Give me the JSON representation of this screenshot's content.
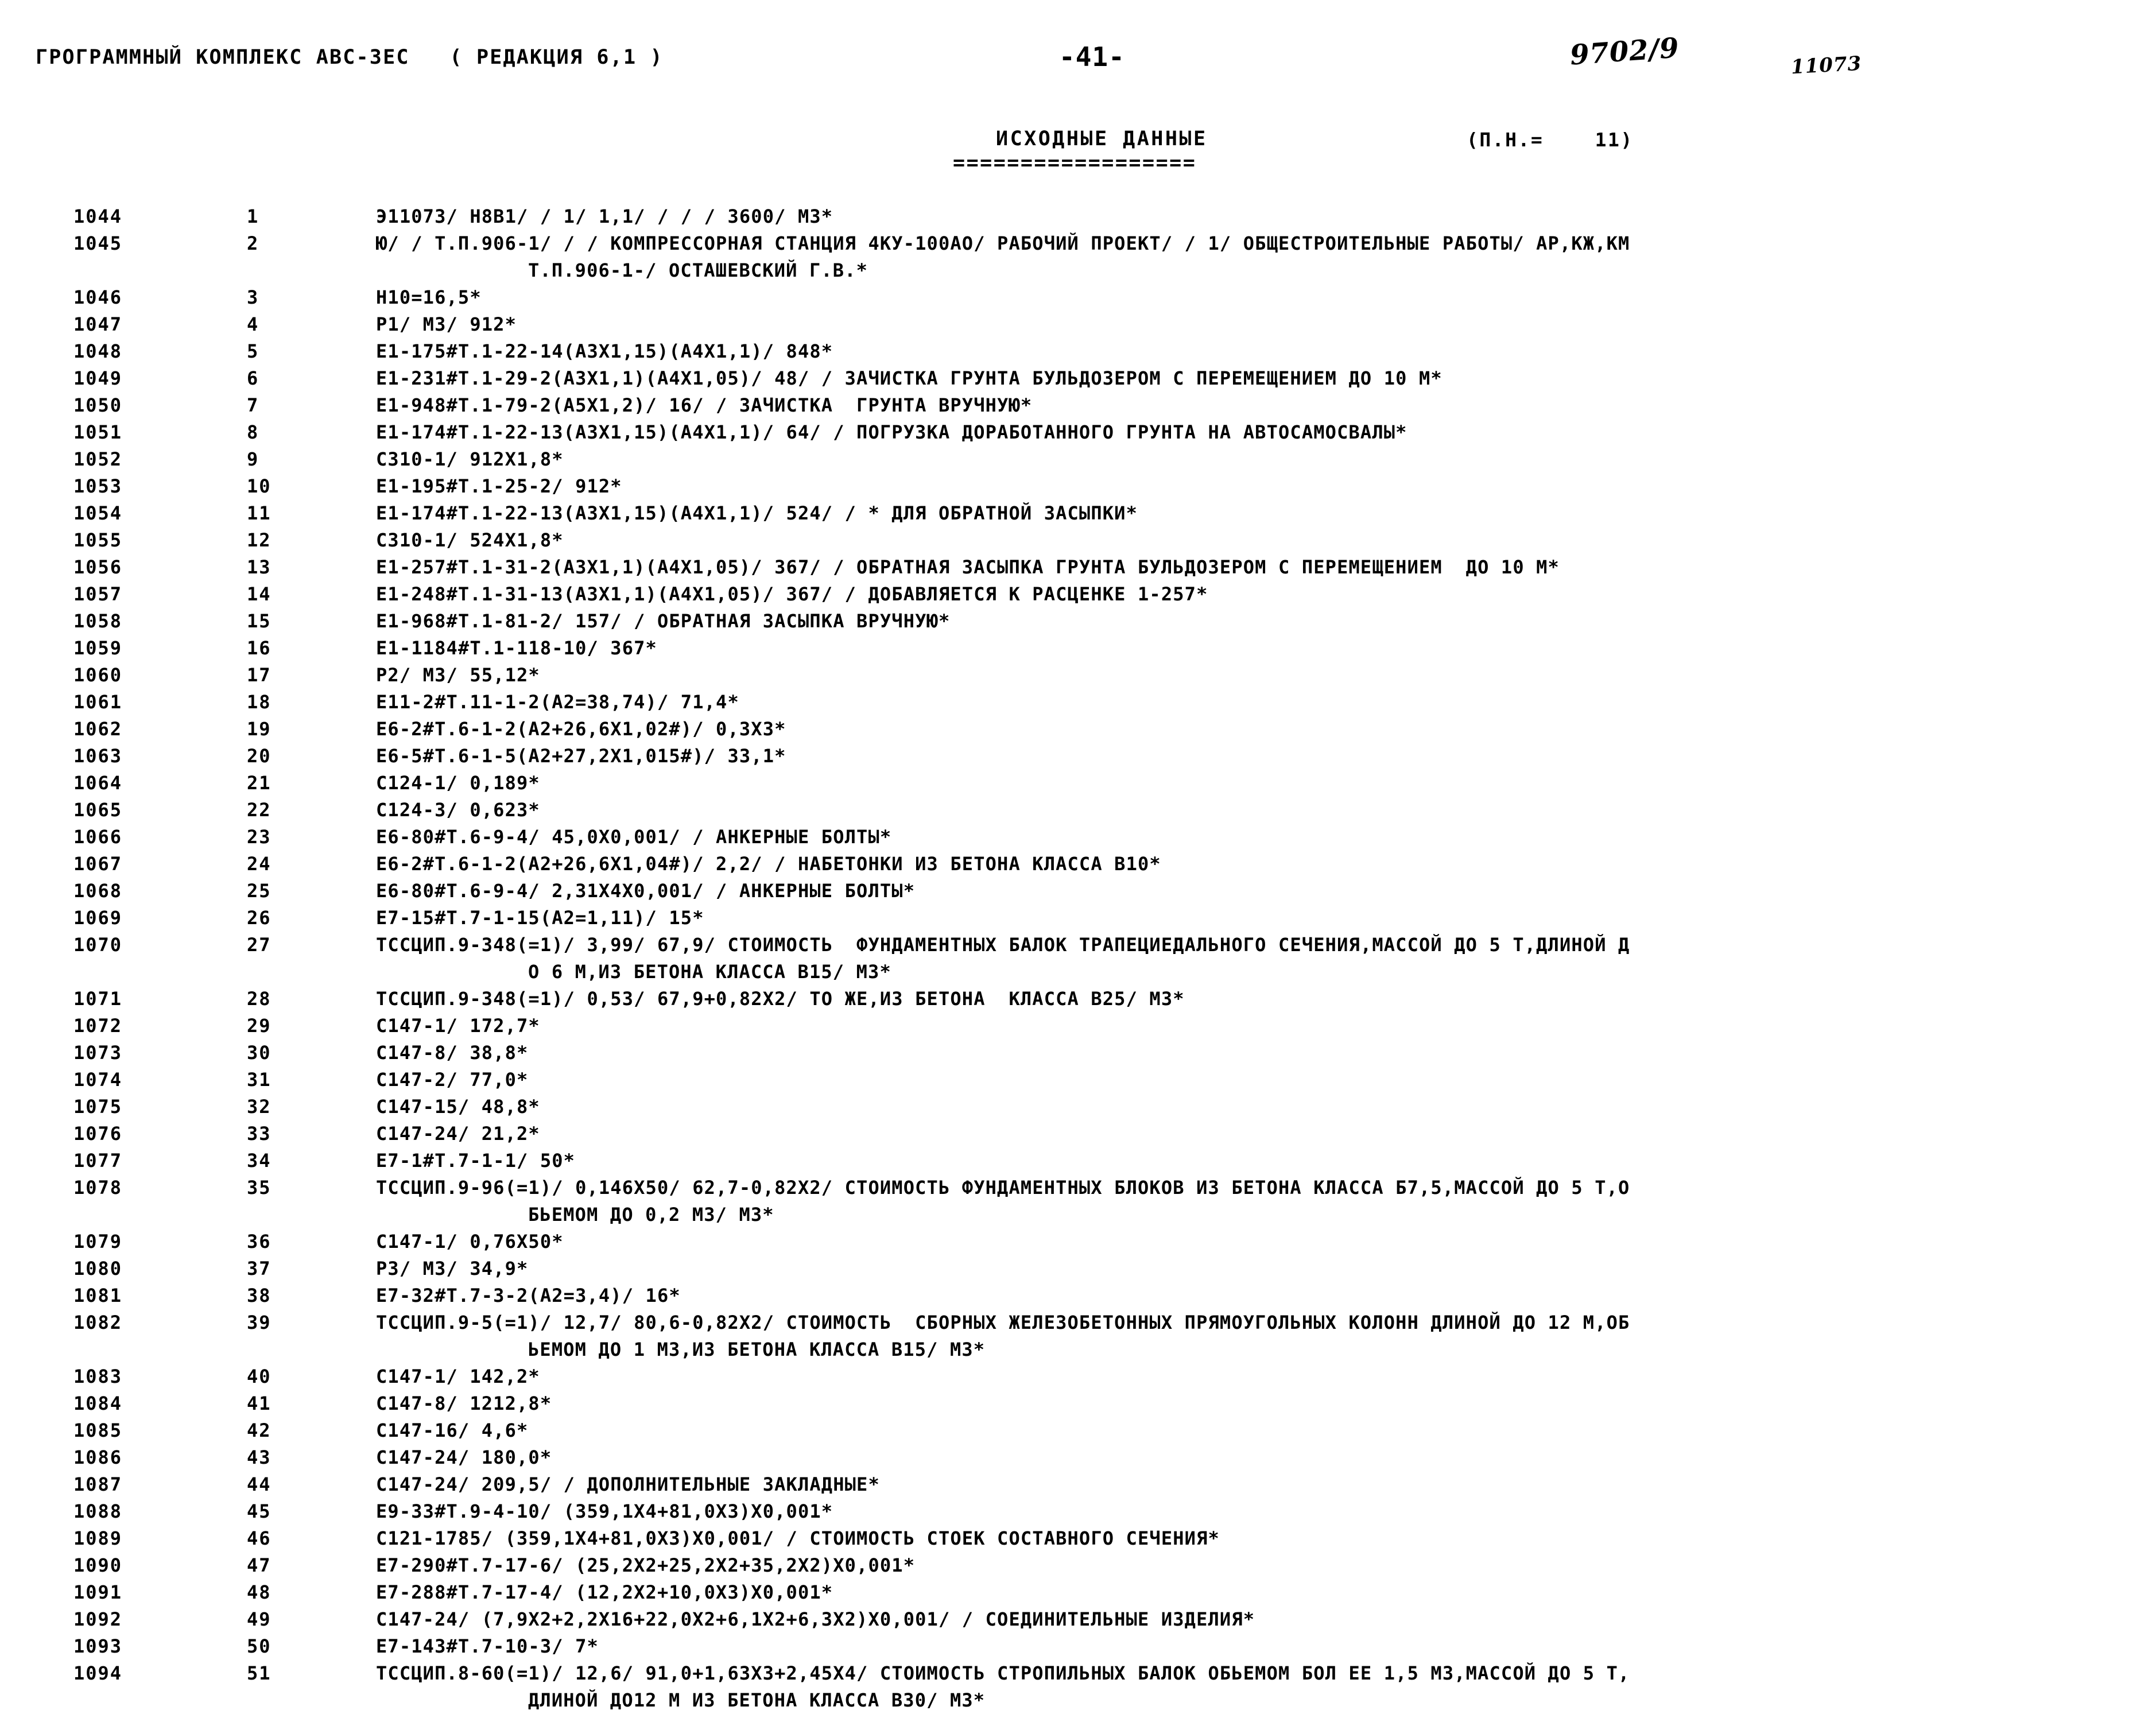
{
  "header": {
    "left_title": "ГРОГРАММНЫЙ КОМПЛЕКС АВС-3ЕС   ( РЕДАКЦИЯ 6,1 )",
    "page_number": "-41-",
    "stamp_number": "9702/9",
    "stamp_code": "11073"
  },
  "title": {
    "main": "ИСХОДНЫЕ ДАННЫЕ",
    "rule": "==================",
    "right": "(П.Н.=    11)"
  },
  "listing": {
    "rows": [
      {
        "lineno": "1044",
        "seq": "1",
        "text": "Э11073/ Н8В1/ / 1/ 1,1/ / / / 3600/ М3*",
        "cont": false
      },
      {
        "lineno": "1045",
        "seq": "2",
        "text": "Ю/ / Т.П.906-1/ / / КОМПРЕССОРНАЯ СТАНЦИЯ 4КУ-100АО/ РАБОЧИЙ ПРОЕКТ/ / 1/ ОБЩЕСТРОИТЕЛЬНЫЕ РАБОТЫ/ АР,КЖ,КМ",
        "cont": false
      },
      {
        "lineno": "",
        "seq": "",
        "text": "Т.П.906-1-/ ОСТАШЕВСКИЙ Г.В.*",
        "cont": true
      },
      {
        "lineno": "1046",
        "seq": "3",
        "text": "Н10=16,5*",
        "cont": false
      },
      {
        "lineno": "1047",
        "seq": "4",
        "text": "Р1/ М3/ 912*",
        "cont": false
      },
      {
        "lineno": "1048",
        "seq": "5",
        "text": "Е1-175#Т.1-22-14(А3Х1,15)(А4Х1,1)/ 848*",
        "cont": false
      },
      {
        "lineno": "1049",
        "seq": "6",
        "text": "Е1-231#Т.1-29-2(А3Х1,1)(А4Х1,05)/ 48/ / ЗАЧИСТКА ГРУНТА БУЛЬДОЗЕРОМ С ПЕРЕМЕЩЕНИЕМ ДО 10 М*",
        "cont": false
      },
      {
        "lineno": "1050",
        "seq": "7",
        "text": "Е1-948#Т.1-79-2(А5Х1,2)/ 16/ / ЗАЧИСТКА  ГРУНТА ВРУЧНУЮ*",
        "cont": false
      },
      {
        "lineno": "1051",
        "seq": "8",
        "text": "Е1-174#Т.1-22-13(А3Х1,15)(А4Х1,1)/ 64/ / ПОГРУЗКА ДОРАБОТАННОГО ГРУНТА НА АВТОСАМОСВАЛЫ*",
        "cont": false
      },
      {
        "lineno": "1052",
        "seq": "9",
        "text": "С310-1/ 912Х1,8*",
        "cont": false
      },
      {
        "lineno": "1053",
        "seq": "10",
        "text": "Е1-195#Т.1-25-2/ 912*",
        "cont": false
      },
      {
        "lineno": "1054",
        "seq": "11",
        "text": "Е1-174#Т.1-22-13(А3Х1,15)(А4Х1,1)/ 524/ / * ДЛЯ ОБРАТНОЙ ЗАСЫПКИ*",
        "cont": false
      },
      {
        "lineno": "1055",
        "seq": "12",
        "text": "С310-1/ 524Х1,8*",
        "cont": false
      },
      {
        "lineno": "1056",
        "seq": "13",
        "text": "Е1-257#Т.1-31-2(А3Х1,1)(А4Х1,05)/ 367/ / ОБРАТНАЯ ЗАСЫПКА ГРУНТА БУЛЬДОЗЕРОМ С ПЕРЕМЕЩЕНИЕМ  ДО 10 М*",
        "cont": false
      },
      {
        "lineno": "1057",
        "seq": "14",
        "text": "Е1-248#Т.1-31-13(А3Х1,1)(А4Х1,05)/ 367/ / ДОБАВЛЯЕТСЯ К РАСЦЕНКЕ 1-257*",
        "cont": false
      },
      {
        "lineno": "1058",
        "seq": "15",
        "text": "Е1-968#Т.1-81-2/ 157/ / ОБРАТНАЯ ЗАСЫПКА ВРУЧНУЮ*",
        "cont": false
      },
      {
        "lineno": "1059",
        "seq": "16",
        "text": "Е1-1184#Т.1-118-10/ 367*",
        "cont": false
      },
      {
        "lineno": "1060",
        "seq": "17",
        "text": "Р2/ М3/ 55,12*",
        "cont": false
      },
      {
        "lineno": "1061",
        "seq": "18",
        "text": "Е11-2#Т.11-1-2(А2=38,74)/ 71,4*",
        "cont": false
      },
      {
        "lineno": "1062",
        "seq": "19",
        "text": "Е6-2#Т.6-1-2(А2+26,6Х1,02#)/ 0,3Х3*",
        "cont": false
      },
      {
        "lineno": "1063",
        "seq": "20",
        "text": "Е6-5#Т.6-1-5(А2+27,2Х1,015#)/ 33,1*",
        "cont": false
      },
      {
        "lineno": "1064",
        "seq": "21",
        "text": "С124-1/ 0,189*",
        "cont": false
      },
      {
        "lineno": "1065",
        "seq": "22",
        "text": "С124-3/ 0,623*",
        "cont": false
      },
      {
        "lineno": "1066",
        "seq": "23",
        "text": "Е6-80#Т.6-9-4/ 45,0Х0,001/ / АНКЕРНЫЕ БОЛТЫ*",
        "cont": false
      },
      {
        "lineno": "1067",
        "seq": "24",
        "text": "Е6-2#Т.6-1-2(А2+26,6Х1,04#)/ 2,2/ / НАБЕТОНКИ ИЗ БЕТОНА КЛАССА В10*",
        "cont": false
      },
      {
        "lineno": "1068",
        "seq": "25",
        "text": "Е6-80#Т.6-9-4/ 2,31Х4Х0,001/ / АНКЕРНЫЕ БОЛТЫ*",
        "cont": false
      },
      {
        "lineno": "1069",
        "seq": "26",
        "text": "Е7-15#Т.7-1-15(А2=1,11)/ 15*",
        "cont": false
      },
      {
        "lineno": "1070",
        "seq": "27",
        "text": "ТССЦИП.9-348(=1)/ 3,99/ 67,9/ СТОИМОСТЬ  ФУНДАМЕНТНЫХ БАЛОК ТРАПЕЦИЕДАЛЬНОГО СЕЧЕНИЯ,МАССОЙ ДО 5 Т,ДЛИНОЙ Д",
        "cont": false
      },
      {
        "lineno": "",
        "seq": "",
        "text": "О 6 М,ИЗ БЕТОНА КЛАССА В15/ М3*",
        "cont": true
      },
      {
        "lineno": "1071",
        "seq": "28",
        "text": "ТССЦИП.9-348(=1)/ 0,53/ 67,9+0,82Х2/ ТО ЖЕ,ИЗ БЕТОНА  КЛАССА В25/ М3*",
        "cont": false
      },
      {
        "lineno": "1072",
        "seq": "29",
        "text": "С147-1/ 172,7*",
        "cont": false
      },
      {
        "lineno": "1073",
        "seq": "30",
        "text": "С147-8/ 38,8*",
        "cont": false
      },
      {
        "lineno": "1074",
        "seq": "31",
        "text": "С147-2/ 77,0*",
        "cont": false
      },
      {
        "lineno": "1075",
        "seq": "32",
        "text": "С147-15/ 48,8*",
        "cont": false
      },
      {
        "lineno": "1076",
        "seq": "33",
        "text": "С147-24/ 21,2*",
        "cont": false
      },
      {
        "lineno": "1077",
        "seq": "34",
        "text": "Е7-1#Т.7-1-1/ 50*",
        "cont": false
      },
      {
        "lineno": "1078",
        "seq": "35",
        "text": "ТССЦИП.9-96(=1)/ 0,146Х50/ 62,7-0,82Х2/ СТОИМОСТЬ ФУНДАМЕНТНЫХ БЛОКОВ ИЗ БЕТОНА КЛАССА Б7,5,МАССОЙ ДО 5 Т,О",
        "cont": false
      },
      {
        "lineno": "",
        "seq": "",
        "text": "БЬЕМОМ ДО 0,2 М3/ М3*",
        "cont": true
      },
      {
        "lineno": "1079",
        "seq": "36",
        "text": "С147-1/ 0,76Х50*",
        "cont": false
      },
      {
        "lineno": "1080",
        "seq": "37",
        "text": "Р3/ М3/ 34,9*",
        "cont": false
      },
      {
        "lineno": "1081",
        "seq": "38",
        "text": "Е7-32#Т.7-3-2(А2=3,4)/ 16*",
        "cont": false
      },
      {
        "lineno": "1082",
        "seq": "39",
        "text": "ТССЦИП.9-5(=1)/ 12,7/ 80,6-0,82Х2/ СТОИМОСТЬ  СБОРНЫХ ЖЕЛЕЗОБЕТОННЫХ ПРЯМОУГОЛЬНЫХ КОЛОНН ДЛИНОЙ ДО 12 М,ОБ",
        "cont": false
      },
      {
        "lineno": "",
        "seq": "",
        "text": "ЬЕМОМ ДО 1 М3,ИЗ БЕТОНА КЛАССА В15/ М3*",
        "cont": true
      },
      {
        "lineno": "1083",
        "seq": "40",
        "text": "С147-1/ 142,2*",
        "cont": false
      },
      {
        "lineno": "1084",
        "seq": "41",
        "text": "С147-8/ 1212,8*",
        "cont": false
      },
      {
        "lineno": "1085",
        "seq": "42",
        "text": "С147-16/ 4,6*",
        "cont": false
      },
      {
        "lineno": "1086",
        "seq": "43",
        "text": "С147-24/ 180,0*",
        "cont": false
      },
      {
        "lineno": "1087",
        "seq": "44",
        "text": "С147-24/ 209,5/ / ДОПОЛНИТЕЛЬНЫЕ ЗАКЛАДНЫЕ*",
        "cont": false
      },
      {
        "lineno": "1088",
        "seq": "45",
        "text": "Е9-33#Т.9-4-10/ (359,1Х4+81,0Х3)Х0,001*",
        "cont": false
      },
      {
        "lineno": "1089",
        "seq": "46",
        "text": "С121-1785/ (359,1Х4+81,0Х3)Х0,001/ / СТОИМОСТЬ СТОЕК СОСТАВНОГО СЕЧЕНИЯ*",
        "cont": false
      },
      {
        "lineno": "1090",
        "seq": "47",
        "text": "Е7-290#Т.7-17-6/ (25,2Х2+25,2Х2+35,2Х2)Х0,001*",
        "cont": false
      },
      {
        "lineno": "1091",
        "seq": "48",
        "text": "Е7-288#Т.7-17-4/ (12,2Х2+10,0Х3)Х0,001*",
        "cont": false
      },
      {
        "lineno": "1092",
        "seq": "49",
        "text": "С147-24/ (7,9Х2+2,2Х16+22,0Х2+6,1Х2+6,3Х2)Х0,001/ / СОЕДИНИТЕЛЬНЫЕ ИЗДЕЛИЯ*",
        "cont": false
      },
      {
        "lineno": "1093",
        "seq": "50",
        "text": "Е7-143#Т.7-10-3/ 7*",
        "cont": false
      },
      {
        "lineno": "1094",
        "seq": "51",
        "text": "ТССЦИП.8-60(=1)/ 12,6/ 91,0+1,63Х3+2,45Х4/ СТОИМОСТЬ СТРОПИЛЬНЫХ БАЛОК ОБЬЕМОМ БОЛ ЕЕ 1,5 М3,МАССОЙ ДО 5 Т,",
        "cont": false
      },
      {
        "lineno": "",
        "seq": "",
        "text": "ДЛИНОЙ ДО12 М ИЗ БЕТОНА КЛАССА В30/ М3*",
        "cont": true
      }
    ]
  }
}
